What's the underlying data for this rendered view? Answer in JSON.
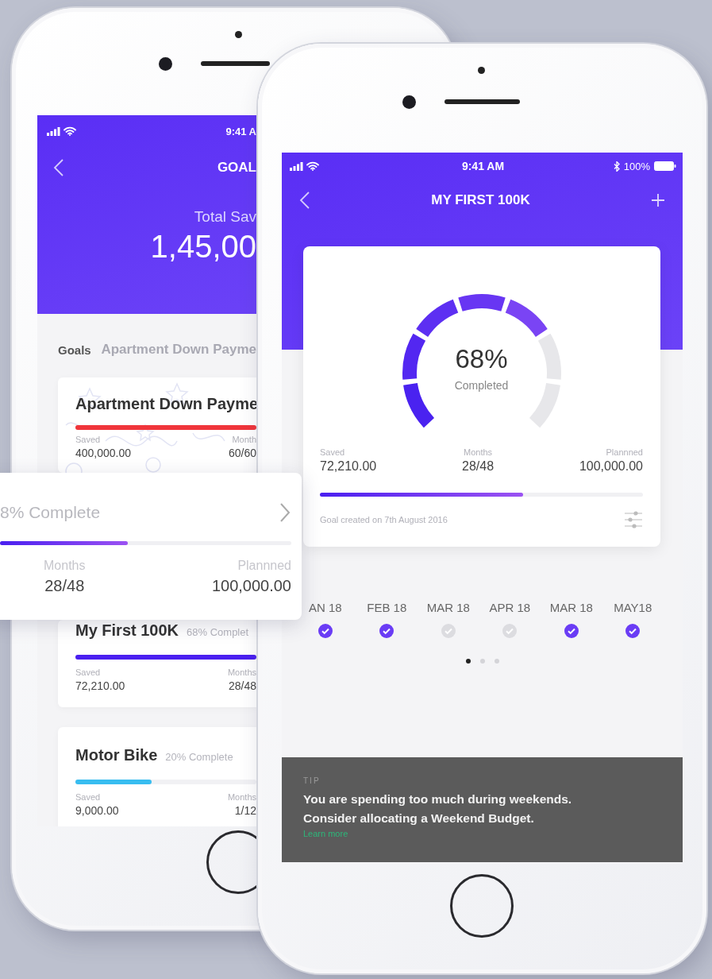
{
  "back_phone": {
    "status_time": "9:41 A",
    "title": "GOAL",
    "total_label": "Total Sav",
    "total_value": "1,45,00",
    "section_label": "Goals",
    "ghost_title": "Apartment Down Payme",
    "goals": [
      {
        "title": "Apartment Down Payme",
        "patterned": true,
        "color": "#f0353b",
        "level": 1,
        "saved_label": "Saved",
        "saved": "400,000.00",
        "months_label": "Month",
        "months": "60/60"
      },
      {
        "title": "My First 100K",
        "complete": "68% Complet",
        "patterned": false,
        "color": "#4a1ff0",
        "level": 1,
        "saved_label": "Saved",
        "saved": "72,210.00",
        "months_label": "Months",
        "months": "28/48"
      },
      {
        "title": "Motor Bike",
        "complete": "20% Complete",
        "patterned": false,
        "color": "#38bdf0",
        "level": 0.42,
        "saved_label": "Saved",
        "saved": "9,000.00",
        "months_label": "Months",
        "months": "1/12"
      }
    ]
  },
  "floating_card": {
    "complete": "8% Complete",
    "level": 0.44,
    "months_label": "Months",
    "months": "28/48",
    "planned_label": "Plannned",
    "planned": "100,000.00"
  },
  "front_phone": {
    "status_time": "9:41 AM",
    "battery": "100%",
    "title": "MY FIRST 100K",
    "gauge": {
      "level": 0.68,
      "value": "68%",
      "caption": "Completed"
    },
    "stats": [
      {
        "label": "Saved",
        "value": "72,210.00"
      },
      {
        "label": "Months",
        "value": "28/48"
      },
      {
        "label": "Plannned",
        "value": "100,000.00"
      }
    ],
    "progress": {
      "level": 0.63
    },
    "created": "Goal created on 7th August 2016",
    "months": [
      {
        "label": "AN 18",
        "checked": true
      },
      {
        "label": "FEB 18",
        "checked": true
      },
      {
        "label": "MAR 18",
        "checked": false
      },
      {
        "label": "APR 18",
        "checked": false
      },
      {
        "label": "MAR 18",
        "checked": true
      },
      {
        "label": "MAY18",
        "checked": true
      }
    ],
    "pager": [
      {
        "selected": true
      },
      {
        "selected": false
      },
      {
        "selected": false
      }
    ],
    "tip": {
      "label": "TIP",
      "lines": [
        "You are spending too much during weekends.",
        "Consider allocating a Weekend Budget."
      ],
      "link": "Learn more"
    }
  }
}
